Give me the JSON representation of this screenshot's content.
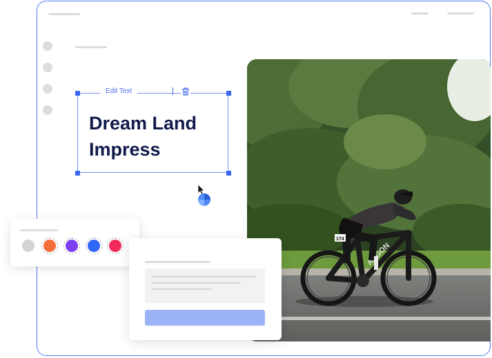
{
  "editor": {
    "toolbar_label": "Edit Text",
    "headline_line1": "Dream Land",
    "headline_line2": "Impress"
  },
  "palette": {
    "colors": [
      "#d4d4d4",
      "#f46e3b",
      "#7b3ff0",
      "#2f66f6",
      "#f02b5b"
    ]
  },
  "photo": {
    "subject": "cyclist on road bike",
    "bib_number": "174",
    "frame_brand": "ARGON"
  },
  "accent_color": "#4d7bf3"
}
